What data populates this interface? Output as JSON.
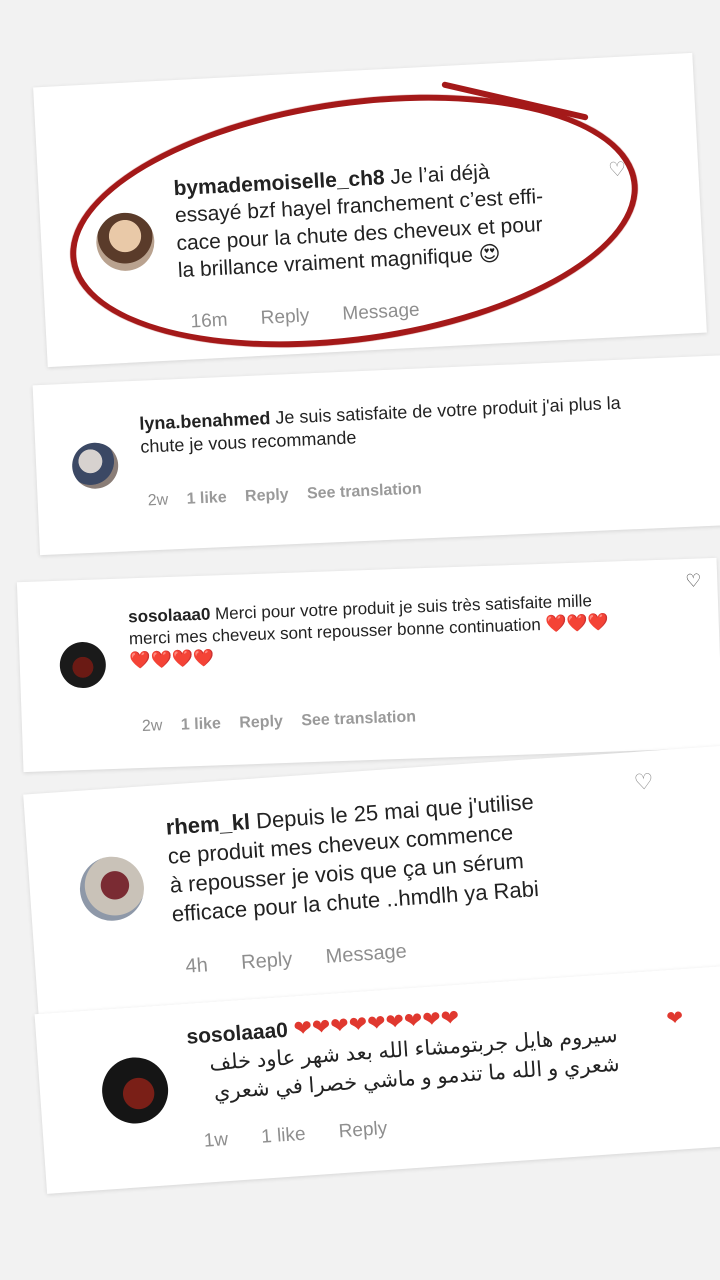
{
  "comments": [
    {
      "username": "bymademoiselle_ch8",
      "lines": [
        "Je l’ai déjà",
        "essayé bzf hayel franchement c’est effi-",
        "cace pour la chute des cheveux et pour",
        "la brillance vraiment magnifique 😍"
      ],
      "time": "16m",
      "reply": "Reply",
      "message": "Message"
    },
    {
      "username": "lyna.benahmed",
      "lines": [
        "Je suis satisfaite de votre produit j'ai plus la",
        "chute je vous recommande"
      ],
      "time": "2w",
      "likes": "1 like",
      "reply": "Reply",
      "translation": "See translation"
    },
    {
      "username": "sosolaaa0",
      "lines": [
        "Merci pour votre produit je suis très satisfaite mille",
        "merci mes cheveux sont repousser bonne continuation ❤️❤️❤️",
        "❤️❤️❤️❤️"
      ],
      "time": "2w",
      "likes": "1 like",
      "reply": "Reply",
      "translation": "See translation"
    },
    {
      "username": "rhem_kl",
      "lines": [
        "Depuis le 25 mai que j'utilise",
        "ce produit mes cheveux commence",
        "à repousser je vois que ça un sérum",
        "efficace pour la chute ..hmdlh ya Rabi"
      ],
      "time": "4h",
      "reply": "Reply",
      "message": "Message"
    },
    {
      "username": "sosolaaa0",
      "hearts": "❤❤❤❤❤❤❤❤❤",
      "lines": [
        "سيروم هايل جربتومشاء الله بعد شهر عاود خلف",
        "شعري و الله ما تندمو و ماشي خصرا في شعري"
      ],
      "time": "1w",
      "likes": "1 like",
      "reply": "Reply"
    }
  ],
  "icons": {
    "heart_outline": "♡",
    "heart_filled": "❤"
  },
  "colors": {
    "highlight_oval": "#a41919",
    "liked_heart": "#e0382f",
    "meta_text": "#8e8e8e"
  }
}
